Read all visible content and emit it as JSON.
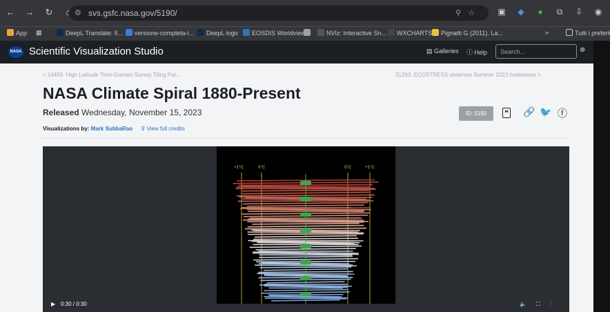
{
  "browser": {
    "url": "svs.gsfc.nasa.gov/5190/",
    "nav_icons": [
      "back-icon",
      "forward-icon",
      "reload-icon",
      "home-icon"
    ],
    "bookmarks": [
      "App",
      "DeepL Translate: Il...",
      "versione-completa-i...",
      "DeepL logo",
      "EOSDIS Worldview",
      "NVIz: Interactive Sn...",
      "WXCHARTS",
      "Pignatti G (2011). La...",
      "Tutti i preferiti"
    ]
  },
  "svs": {
    "title": "Scientific Visualization Studio",
    "galleries": "Galleries",
    "help": "Help",
    "search_placeholder": "Search..."
  },
  "page": {
    "prev_link": "< 14456: High Latitude Time-Domain Survey Tiling Pat...",
    "next_link": "31263: ECOSTRESS observes Summer 2023 heatwaves >",
    "title": "NASA Climate Spiral 1880-Present",
    "released_label": "Released",
    "released_date": "Wednesday, November 15, 2023",
    "id_badge": "ID: 5190",
    "credits_label": "Visualizations by:",
    "credits_author": "Mark SubbaRao",
    "view_credits": "View full credits"
  },
  "video": {
    "time": "0:30 / 0:30",
    "axis_labels": [
      "+1°C",
      "0°C",
      "0°C",
      "+1°C"
    ]
  },
  "colors": {
    "chrome": "#35363a",
    "svs_bar": "#1c1f24",
    "link": "#2f74c0"
  }
}
